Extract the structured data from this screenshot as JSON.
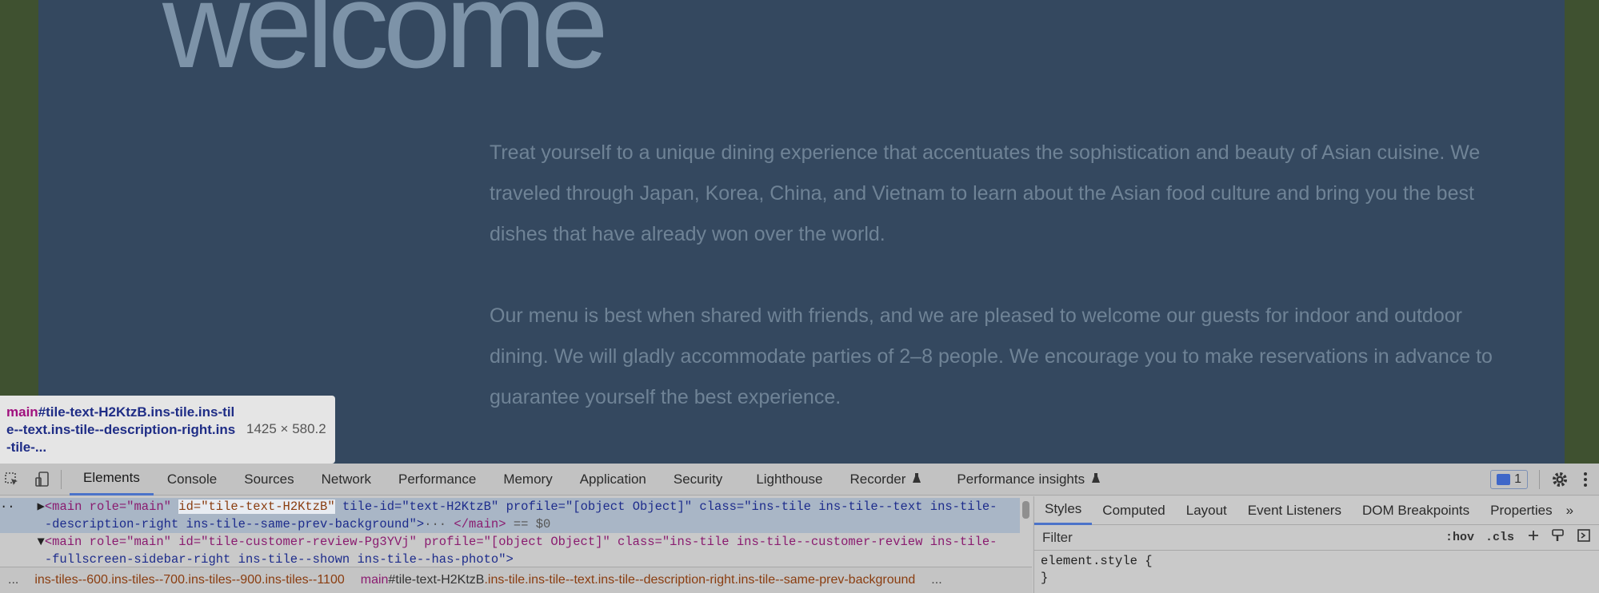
{
  "site": {
    "heading": "welcome",
    "paragraph1": "Treat yourself to a unique dining experience that accentuates the sophistication and beauty of Asian cuisine. We traveled through Japan, Korea, China, and Vietnam to learn about the Asian food culture and bring you the best dishes that have already won over the world.",
    "paragraph2": "Our menu is best when shared with friends, and we are pleased to welcome our guests for indoor and outdoor dining. We will gladly accommodate parties of 2–8 people. We encourage you to make reservations in advance to guarantee yourself the best experience."
  },
  "tooltip": {
    "tag": "main",
    "selector": "#tile-text-H2KtzB.ins-tile.ins-tile--text.ins-tile--description-right.ins-tile-...",
    "size": "1425 × 580.2"
  },
  "devtools": {
    "tabs": [
      {
        "label": "Elements",
        "active": true
      },
      {
        "label": "Console"
      },
      {
        "label": "Sources"
      },
      {
        "label": "Network"
      },
      {
        "label": "Performance"
      },
      {
        "label": "Memory"
      },
      {
        "label": "Application"
      },
      {
        "label": "Security"
      },
      {
        "label": "Lighthouse"
      },
      {
        "label": "Recorder"
      },
      {
        "label": "Performance insights"
      }
    ],
    "issues_count": "1",
    "elements": {
      "line1_part1": "<main role=\"main\" ",
      "line1_id": "id=\"tile-text-H2KtzB\"",
      "line1_part2": " tile-id=\"text-H2KtzB\" profile=\"[object Object]\" class=\"ins-tile ins-tile--text ins-tile-",
      "line2": "-description-right ins-tile--same-prev-background\">",
      "line2_ellipsis": "···",
      "line2_end": "</main>",
      "line2_eq": " == $0",
      "line3": "<main role=\"main\" id=\"tile-customer-review-Pg3YVj\" profile=\"[object Object]\" class=\"ins-tile ins-tile--customer-review ins-tile-",
      "line4": "-fullscreen-sidebar-right ins-tile--shown ins-tile--has-photo\">"
    },
    "styles_tabs": [
      {
        "label": "Styles",
        "active": true
      },
      {
        "label": "Computed"
      },
      {
        "label": "Layout"
      },
      {
        "label": "Event Listeners"
      },
      {
        "label": "DOM Breakpoints"
      },
      {
        "label": "Properties"
      }
    ],
    "filter_placeholder": "Filter",
    "hov": ":hov",
    "cls": ".cls",
    "element_style_open": "element.style {",
    "element_style_close": "}",
    "breadcrumbs": {
      "ellipsis": "...",
      "crumb1": "ins-tiles--600.ins-tiles--700.ins-tiles--900.ins-tiles--1100",
      "crumb2_tag": "main",
      "crumb2_id": "#tile-text-H2KtzB",
      "crumb2_rest": ".ins-tile.ins-tile--text.ins-tile--description-right.ins-tile--same-prev-background",
      "more": "..."
    }
  }
}
